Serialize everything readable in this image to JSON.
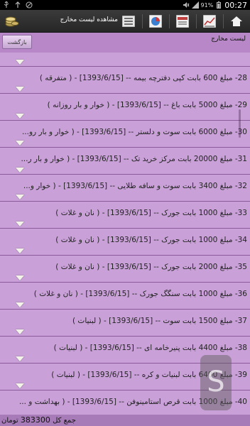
{
  "status_bar": {
    "battery": "91%",
    "time": "00:27"
  },
  "action_bar": {
    "title": "مشاهده لیست مخارج"
  },
  "sub_header": {
    "title": "لیست مخارج",
    "back_label": "بازگشت"
  },
  "rows": [
    {
      "text": "28- مبلغ 600 بابت کپی دفترچه بیمه -- [1393/6/15] - ( متفرقه )",
      "wrap": ""
    },
    {
      "text": "29- مبلغ 5000 بابت باغ -- [1393/6/15] - ( خوار و بار روزانه )",
      "wrap": ""
    },
    {
      "text": "30- مبلغ 6000 بابت سوت و دلستر -- [1393/6/15] - ( خوار و بار رو...",
      "wrap": ""
    },
    {
      "text": "31- مبلغ 20000 بابت مرکز خرید تک -- [1393/6/15] - ( خوار و بار ر...",
      "wrap": ""
    },
    {
      "text": "32- مبلغ 3400 بابت سوت و سافه طلایی -- [1393/6/15] - ( خوار و...",
      "wrap": ""
    },
    {
      "text": "33- مبلغ 1000 بابت جورک -- [1393/6/15] - ( نان و غلات )",
      "wrap": ""
    },
    {
      "text": "34- مبلغ 1000 بابت جورک -- [1393/6/15] - ( نان و غلات )",
      "wrap": ""
    },
    {
      "text": "35- مبلغ 2000 بابت جورک -- [1393/6/15] - ( نان و غلات )",
      "wrap": ""
    },
    {
      "text": "36- مبلغ 1000 بابت سنگگ جورک -- [1393/6/15] - ( نان و غلات )",
      "wrap": ""
    },
    {
      "text": "37- مبلغ 1500 بابت سوت -- [1393/6/15] - ( لبنیات )",
      "wrap": ""
    },
    {
      "text": "38- مبلغ 4400 بابت پنیرخامه ای -- [1393/6/15] - ( لبنیات )",
      "wrap": ""
    },
    {
      "text": "39- مبلغ 6400 بابت لبنیات و کره -- [1393/6/15] - ( لبنیات )",
      "wrap": ""
    },
    {
      "text": "40- مبلغ 1000 بابت قرص استامینوفن -- [1393/6/15] - ( بهداشت و ...",
      "wrap": ""
    }
  ],
  "footer": {
    "label": "جمع کل",
    "total": "383300",
    "unit": "تومان"
  },
  "colors": {
    "background": "#c9a0d8",
    "divider": "#8a5a9a",
    "actionbar": "#2f2f2f"
  }
}
